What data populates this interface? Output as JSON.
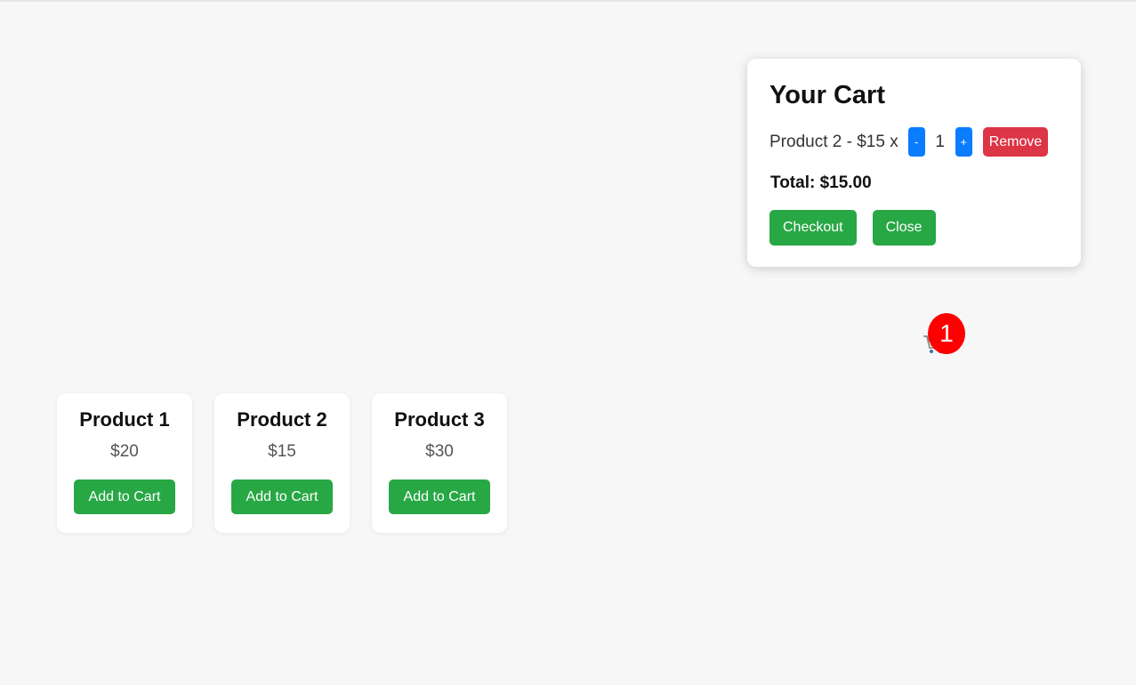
{
  "cart": {
    "title": "Your Cart",
    "item": {
      "text": "Product 2 - $15 x",
      "decrement_label": "-",
      "quantity": "1",
      "increment_label": "+",
      "remove_label": "Remove"
    },
    "total": "Total: $15.00",
    "checkout_label": "Checkout",
    "close_label": "Close"
  },
  "cart_icon": {
    "icon": "shopping-cart-icon",
    "badge_count": "1"
  },
  "products": [
    {
      "name": "Product 1",
      "price": "$20",
      "button_label": "Add to Cart"
    },
    {
      "name": "Product 2",
      "price": "$15",
      "button_label": "Add to Cart"
    },
    {
      "name": "Product 3",
      "price": "$30",
      "button_label": "Add to Cart"
    }
  ],
  "colors": {
    "green": "#28a745",
    "blue": "#0a7cff",
    "red": "#dc3545",
    "badge": "#ff0000",
    "background": "#f7f7f7"
  }
}
